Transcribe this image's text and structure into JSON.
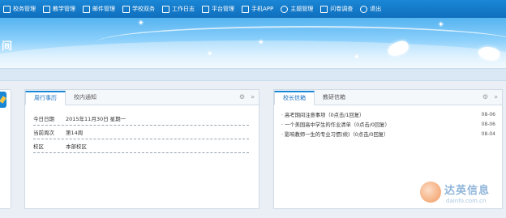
{
  "nav": {
    "items": [
      {
        "label": "校务管理",
        "icon": "home-icon"
      },
      {
        "label": "教学管理",
        "icon": "edit-icon"
      },
      {
        "label": "邮件管理",
        "icon": "mail-icon"
      },
      {
        "label": "学校双务",
        "icon": "book-icon"
      },
      {
        "label": "工作日志",
        "icon": "monitor-icon"
      },
      {
        "label": "平台管理",
        "icon": "platform-icon"
      },
      {
        "label": "手机APP",
        "icon": "phone-icon"
      },
      {
        "label": "主题管理",
        "icon": "user-icon"
      },
      {
        "label": "问卷调查",
        "icon": "survey-icon"
      },
      {
        "label": "退出",
        "icon": "power-icon"
      }
    ]
  },
  "banner": {
    "title_fragment": "间"
  },
  "left_panel": {
    "tabs": [
      "周行事历",
      "校内通知"
    ],
    "active_tab": 0,
    "rows": [
      {
        "label": "今日日期",
        "value": "2015年11月30日  星期一"
      },
      {
        "label": "当前周次",
        "value": "第14周"
      },
      {
        "label": "校区",
        "value": "本部校区"
      }
    ]
  },
  "right_panel": {
    "tabs": [
      "校长信箱",
      "教研信箱"
    ],
    "active_tab": 0,
    "items": [
      {
        "text": "· 高考期间注意事项（0点击/1回复）",
        "date": "08-06"
      },
      {
        "text": "· 一个美国高中学生的作业清单（0点击/0回复）",
        "date": "08-06"
      },
      {
        "text": "· 影响教师一生的专业习惯(续)（0点击/0回复）",
        "date": "08-04"
      }
    ]
  },
  "watermark": {
    "brand": "达英信息",
    "domain": "dainfo.com.cn"
  },
  "colors": {
    "nav_bg": "#1a87d6",
    "accent": "#1a6fc0"
  }
}
